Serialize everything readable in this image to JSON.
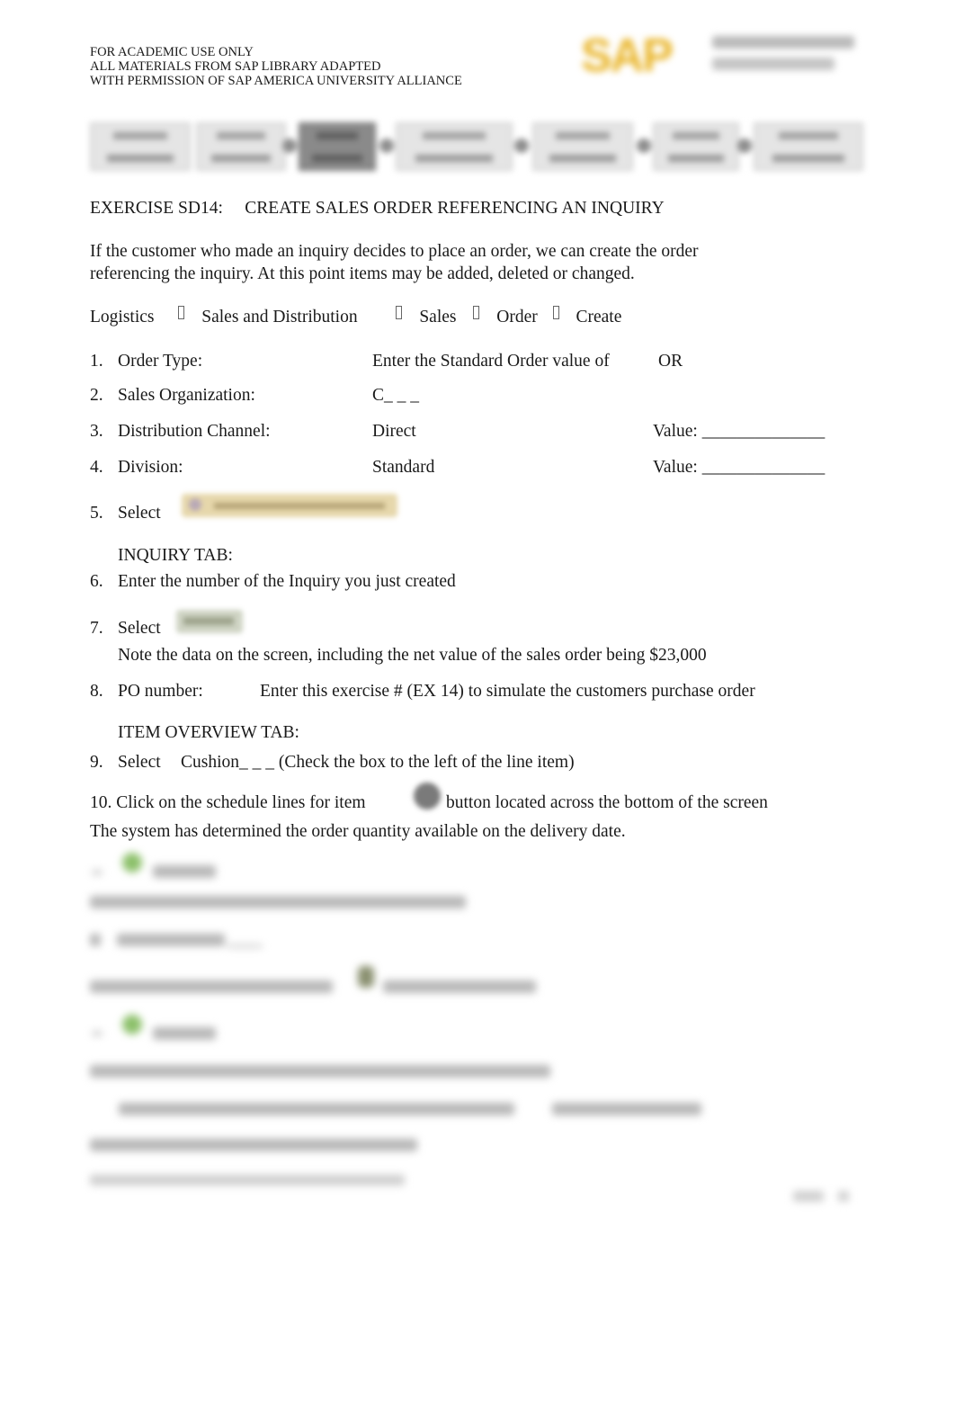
{
  "header": {
    "lines": [
      "FOR ACADEMIC USE ONLY",
      "ALL MATERIALS FROM SAP LIBRARY ADAPTED",
      "WITH PERMISSION OF SAP AMERICA UNIVERSITY ALLIANCE"
    ],
    "logo_icon": "sap-university-alliances-logo",
    "logo_text": "SAP",
    "logo_color": "#e9b52a"
  },
  "process_flow": {
    "note": "blurred",
    "steps": 7,
    "active_step_index": 2
  },
  "exercise": {
    "code": "EXERCISE SD14:",
    "title": "CREATE SALES ORDER REFERENCING AN INQUIRY"
  },
  "intro": [
    "If the customer who made an inquiry decides to place an order, we can create the order",
    "referencing the inquiry. At this point items may be added, deleted or changed."
  ],
  "menu_path": {
    "separator_icon": "arrow-right-icon",
    "items": [
      "Logistics",
      "Sales and Distribution",
      "Sales",
      "Order",
      "Create"
    ]
  },
  "steps": {
    "s1": {
      "num": "1.",
      "label": "Order Type:",
      "value": "Enter the Standard Order value of",
      "extra": "OR"
    },
    "s2": {
      "num": "2.",
      "label": "Sales Organization:",
      "value": "C_ _ _"
    },
    "s3": {
      "num": "3.",
      "label": "Distribution Channel:",
      "value": "Direct",
      "extra": "Value: ______________"
    },
    "s4": {
      "num": "4.",
      "label": "Division:",
      "value": "Standard",
      "extra": "Value: ______________"
    },
    "s5": {
      "num": "5.",
      "text": "Select",
      "button_icon": "create-with-reference-button"
    },
    "inquiry_tab": "INQUIRY TAB:",
    "s6": {
      "num": "6.",
      "text": "Enter the number of the Inquiry you just created"
    },
    "s7": {
      "num": "7.",
      "text": "Select",
      "button_icon": "copy-button",
      "note": "Note the data on the screen, including the net value of the sales order being $23,000"
    },
    "s8": {
      "num": "8.",
      "label": "PO number:",
      "text": "Enter this exercise # (EX 14) to simulate the customers purchase order"
    },
    "item_overview_tab": "ITEM OVERVIEW TAB:",
    "s9": {
      "num": "9.",
      "text": "Select",
      "item": "Cushion_ _ _ (Check the box to the left of the line item)"
    },
    "s10": {
      "num": "10.",
      "text": "Click on the schedule lines for item",
      "button_icon": "schedule-lines-button",
      "after": "button located across the bottom of the screen"
    },
    "s10_note": "The system has determined the order quantity available on the delivery date."
  },
  "blurred_section": {
    "note": "remaining content blurred (preview)"
  }
}
